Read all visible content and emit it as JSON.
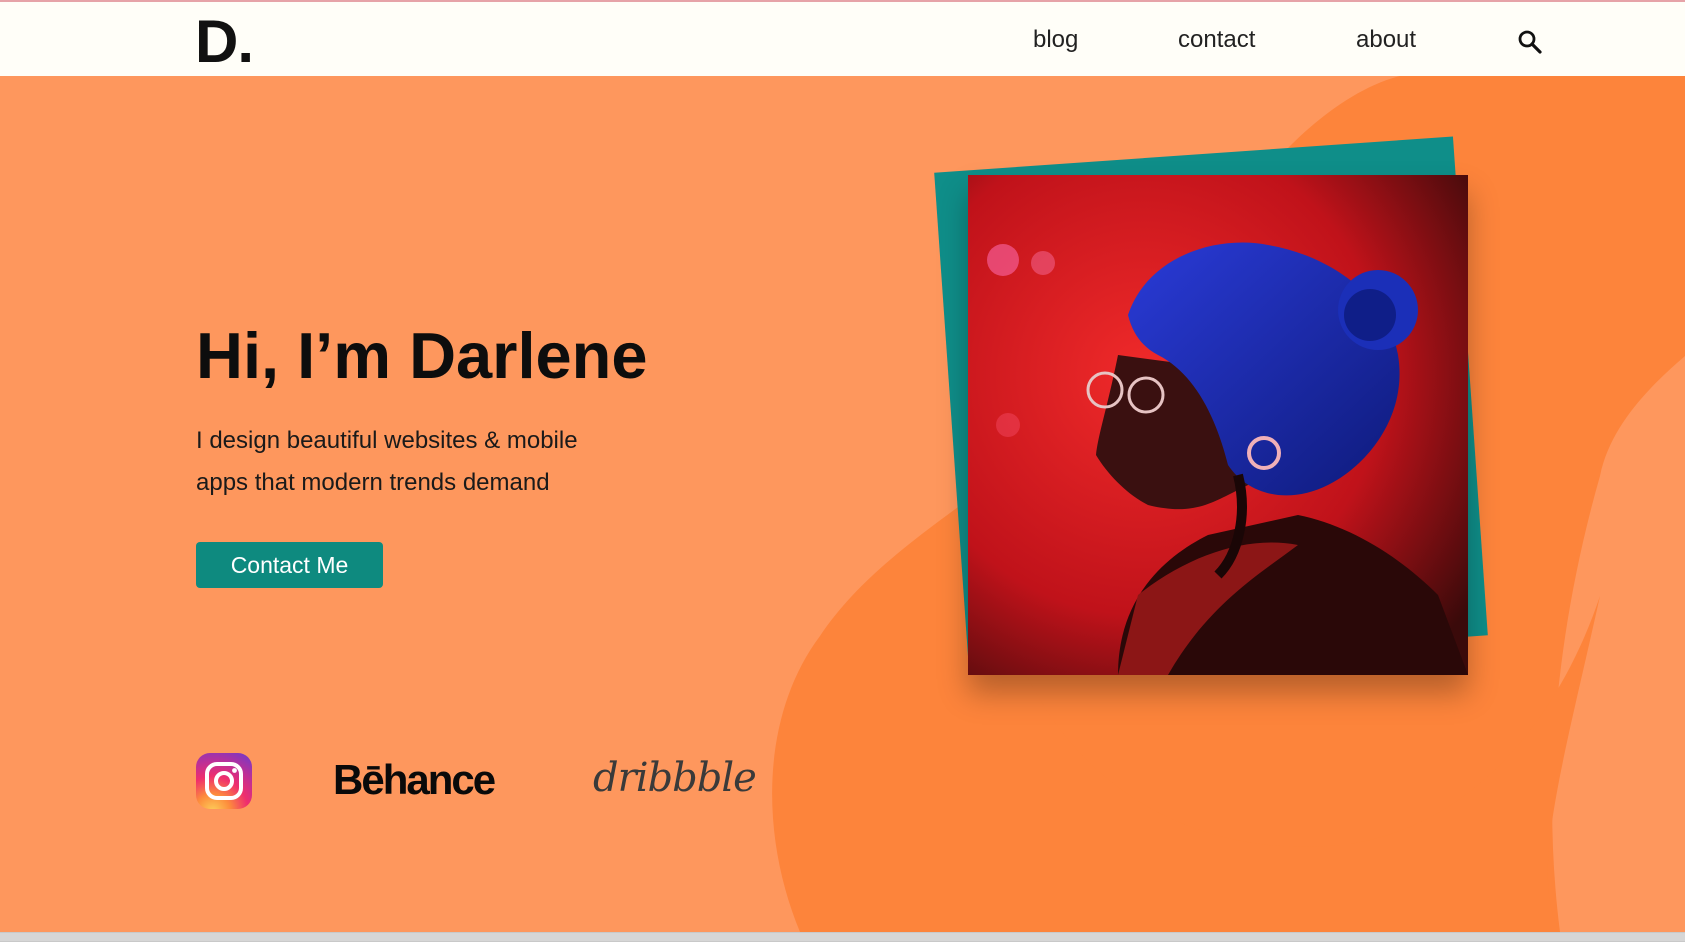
{
  "header": {
    "logo": "D.",
    "nav": [
      {
        "label": "blog"
      },
      {
        "label": "contact"
      },
      {
        "label": "about"
      }
    ],
    "search_icon": "search-icon"
  },
  "hero": {
    "heading": "Hi, I’m Darlene",
    "tagline_line1": "I design beautiful websites & mobile",
    "tagline_line2": "apps that modern trends demand",
    "cta_label": "Contact Me",
    "portrait_alt": "portrait-photo"
  },
  "social": {
    "instagram": "instagram-icon",
    "behance": "Bēhance",
    "dribbble": "dribbble"
  },
  "colors": {
    "hero_bg": "#fe975d",
    "blob": "#fd843b",
    "accent": "#0e8a7f",
    "nav_bg": "#fffef8"
  }
}
